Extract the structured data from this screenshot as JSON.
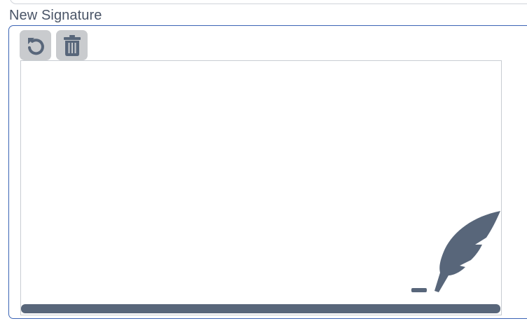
{
  "signature": {
    "label": "New Signature"
  },
  "toolbar": {
    "buttons": [
      {
        "icon": "undo-icon"
      },
      {
        "icon": "trash-icon"
      }
    ]
  },
  "canvas": {
    "placeholder_icon": "feather-pen-icon"
  },
  "colors": {
    "icon": "#58667a",
    "button_bg": "#c9cbce",
    "panel_border": "#3b64b5",
    "label": "#4a5567"
  }
}
